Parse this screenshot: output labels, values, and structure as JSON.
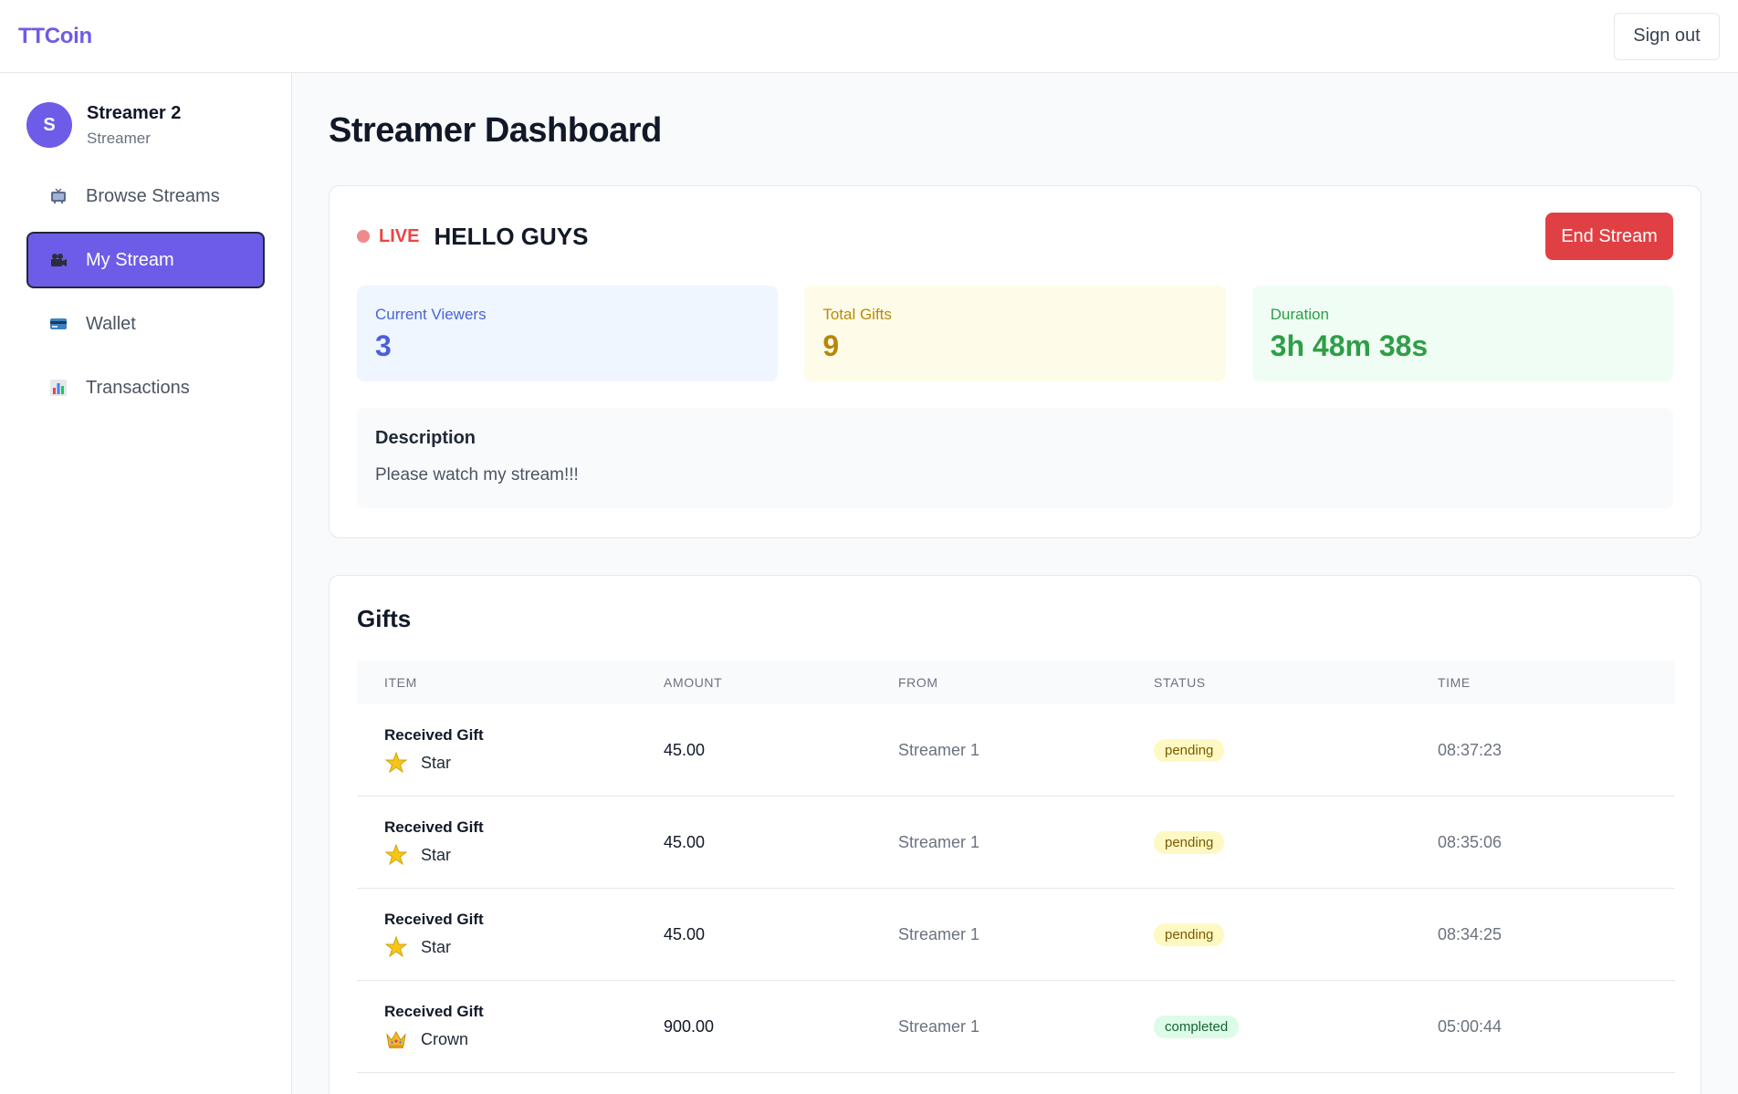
{
  "app": {
    "brand": "TTCoin",
    "sign_out_label": "Sign out"
  },
  "user": {
    "initial": "S",
    "name": "Streamer 2",
    "role": "Streamer"
  },
  "sidebar": {
    "items": [
      {
        "label": "Browse Streams",
        "icon": "tv-icon",
        "active": false
      },
      {
        "label": "My Stream",
        "icon": "video-camera-icon",
        "active": true
      },
      {
        "label": "Wallet",
        "icon": "credit-card-icon",
        "active": false
      },
      {
        "label": "Transactions",
        "icon": "bar-chart-icon",
        "active": false
      }
    ]
  },
  "page": {
    "title": "Streamer Dashboard"
  },
  "stream": {
    "live_label": "LIVE",
    "title": "HELLO GUYS",
    "end_label": "End Stream",
    "stats": [
      {
        "label": "Current Viewers",
        "value": "3"
      },
      {
        "label": "Total Gifts",
        "value": "9"
      },
      {
        "label": "Duration",
        "value": "3h 48m 38s"
      }
    ],
    "description_title": "Description",
    "description_text": "Please watch my stream!!!"
  },
  "gifts": {
    "title": "Gifts",
    "columns": [
      "Item",
      "Amount",
      "From",
      "Status",
      "Time"
    ],
    "rows": [
      {
        "title": "Received Gift",
        "gift": "Star",
        "icon": "star-icon",
        "amount": "45.00",
        "from": "Streamer 1",
        "status": "pending",
        "time": "08:37:23"
      },
      {
        "title": "Received Gift",
        "gift": "Star",
        "icon": "star-icon",
        "amount": "45.00",
        "from": "Streamer 1",
        "status": "pending",
        "time": "08:35:06"
      },
      {
        "title": "Received Gift",
        "gift": "Star",
        "icon": "star-icon",
        "amount": "45.00",
        "from": "Streamer 1",
        "status": "pending",
        "time": "08:34:25"
      },
      {
        "title": "Received Gift",
        "gift": "Crown",
        "icon": "crown-icon",
        "amount": "900.00",
        "from": "Streamer 1",
        "status": "completed",
        "time": "05:00:44"
      }
    ]
  },
  "colors": {
    "accent": "#6d5ce8",
    "danger": "#e04043",
    "live": "#ef4444",
    "viewers": "#4b5fd9",
    "gifts": "#b8860b",
    "duration": "#2f9e48"
  }
}
